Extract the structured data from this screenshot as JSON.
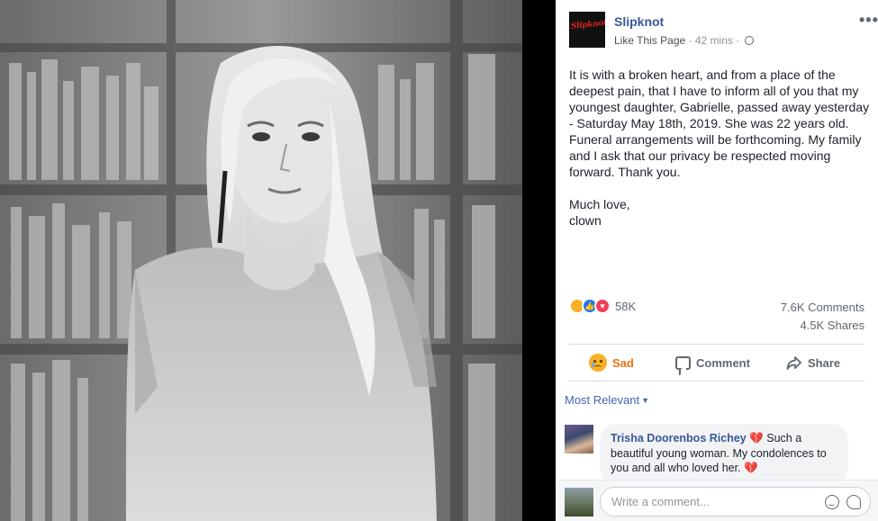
{
  "post": {
    "page_name": "Slipknot",
    "logo_text": "Slipknot",
    "like_link": "Like This Page",
    "separator": " · ",
    "time": "42 mins",
    "more": "•••",
    "paragraph1": "It is with a broken heart, and from a place of the deepest pain, that I have to inform all of you that my youngest daughter, Gabrielle, passed away yesterday - Saturday May 18th, 2019. She was 22 years old. Funeral arrangements will be forthcoming. My family and I ask that our privacy be respected moving forward. Thank you.",
    "paragraph2_line1": "Much love,",
    "paragraph2_line2": "clown"
  },
  "reactions": {
    "count": "58K",
    "comments": "7.6K Comments",
    "shares": "4.5K Shares",
    "icons": [
      "sad-face",
      "thumbs-up",
      "heart"
    ]
  },
  "actions": {
    "reaction_label": "Sad",
    "comment_label": "Comment",
    "share_label": "Share"
  },
  "comments": {
    "sort_label": "Most Relevant",
    "items": [
      {
        "author": "Trisha Doorenbos Richey",
        "text_part1": " Such a beautiful young woman. My condolences to you and all who loved her. "
      }
    ],
    "write_placeholder": "Write a comment..."
  },
  "colors": {
    "link_blue": "#385898",
    "sad_orange": "#e9710f",
    "background": "#000000"
  }
}
